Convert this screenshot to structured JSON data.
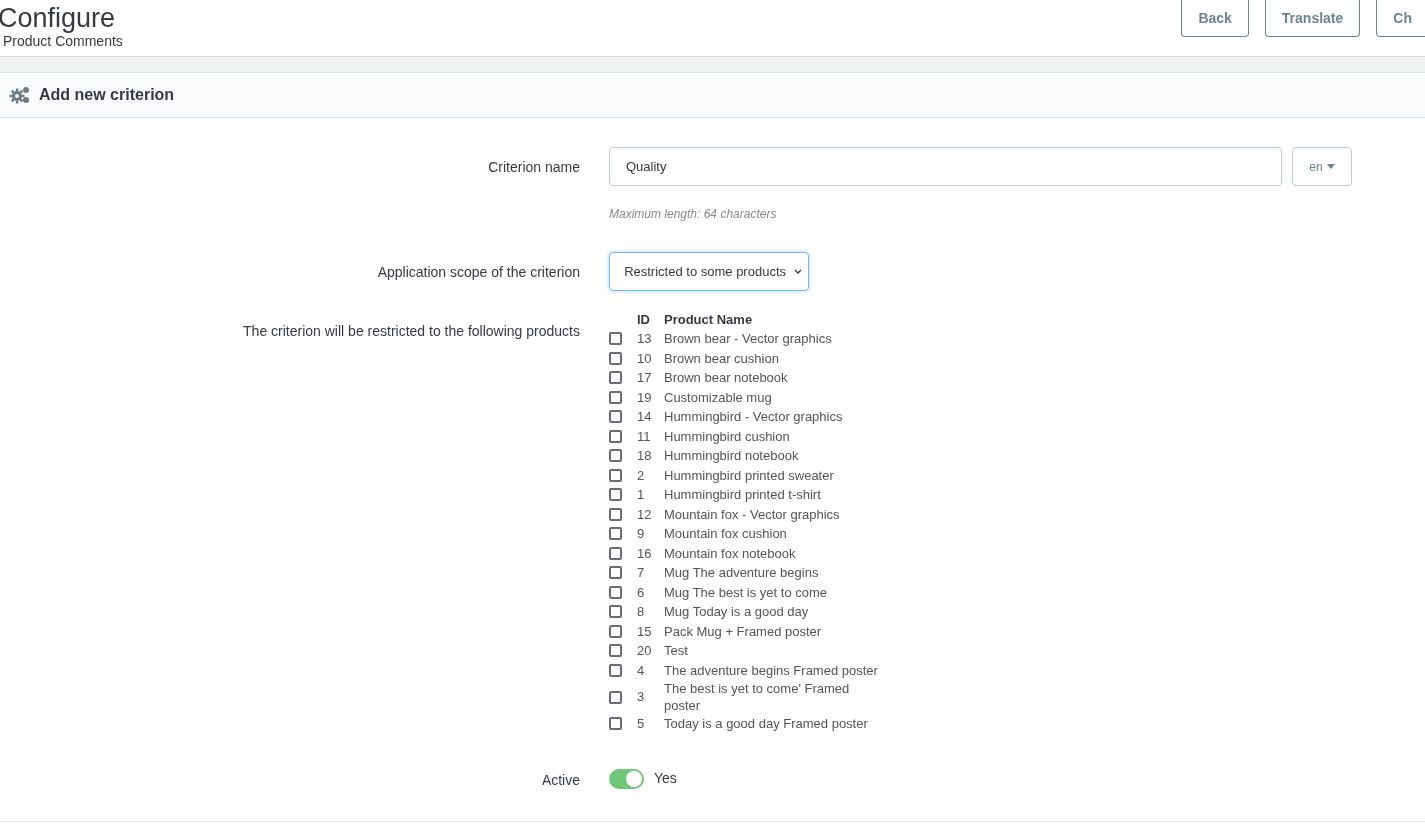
{
  "header": {
    "title": "Configure",
    "subtitle": "Product Comments",
    "buttons": [
      "Back",
      "Translate",
      "Ch"
    ]
  },
  "panel": {
    "title": "Add new criterion"
  },
  "form": {
    "name_label": "Criterion name",
    "name_value": "Quality",
    "language": "en",
    "name_hint": "Maximum length: 64 characters",
    "scope_label": "Application scope of the criterion",
    "scope_value": "Restricted to some products",
    "products_label": "The criterion will be restricted to the following products",
    "products_columns": [
      "ID",
      "Product Name"
    ],
    "products": [
      {
        "id": "13",
        "name": "Brown bear - Vector graphics",
        "checked": false
      },
      {
        "id": "10",
        "name": "Brown bear cushion",
        "checked": false
      },
      {
        "id": "17",
        "name": "Brown bear notebook",
        "checked": false
      },
      {
        "id": "19",
        "name": "Customizable mug",
        "checked": false
      },
      {
        "id": "14",
        "name": "Hummingbird - Vector graphics",
        "checked": false
      },
      {
        "id": "11",
        "name": "Hummingbird cushion",
        "checked": false
      },
      {
        "id": "18",
        "name": "Hummingbird notebook",
        "checked": false
      },
      {
        "id": "2",
        "name": "Hummingbird printed sweater",
        "checked": false
      },
      {
        "id": "1",
        "name": "Hummingbird printed t-shirt",
        "checked": false
      },
      {
        "id": "12",
        "name": "Mountain fox - Vector graphics",
        "checked": false
      },
      {
        "id": "9",
        "name": "Mountain fox cushion",
        "checked": false
      },
      {
        "id": "16",
        "name": "Mountain fox notebook",
        "checked": false
      },
      {
        "id": "7",
        "name": "Mug The adventure begins",
        "checked": false
      },
      {
        "id": "6",
        "name": "Mug The best is yet to come",
        "checked": false
      },
      {
        "id": "8",
        "name": "Mug Today is a good day",
        "checked": false
      },
      {
        "id": "15",
        "name": "Pack Mug + Framed poster",
        "checked": false
      },
      {
        "id": "20",
        "name": "Test",
        "checked": false
      },
      {
        "id": "4",
        "name": "The adventure begins Framed poster",
        "checked": false
      },
      {
        "id": "3",
        "name": "The best is yet to come' Framed poster",
        "checked": false
      },
      {
        "id": "5",
        "name": "Today is a good day Framed poster",
        "checked": false
      }
    ],
    "active_label": "Active",
    "active_on": true,
    "active_text": "Yes"
  }
}
